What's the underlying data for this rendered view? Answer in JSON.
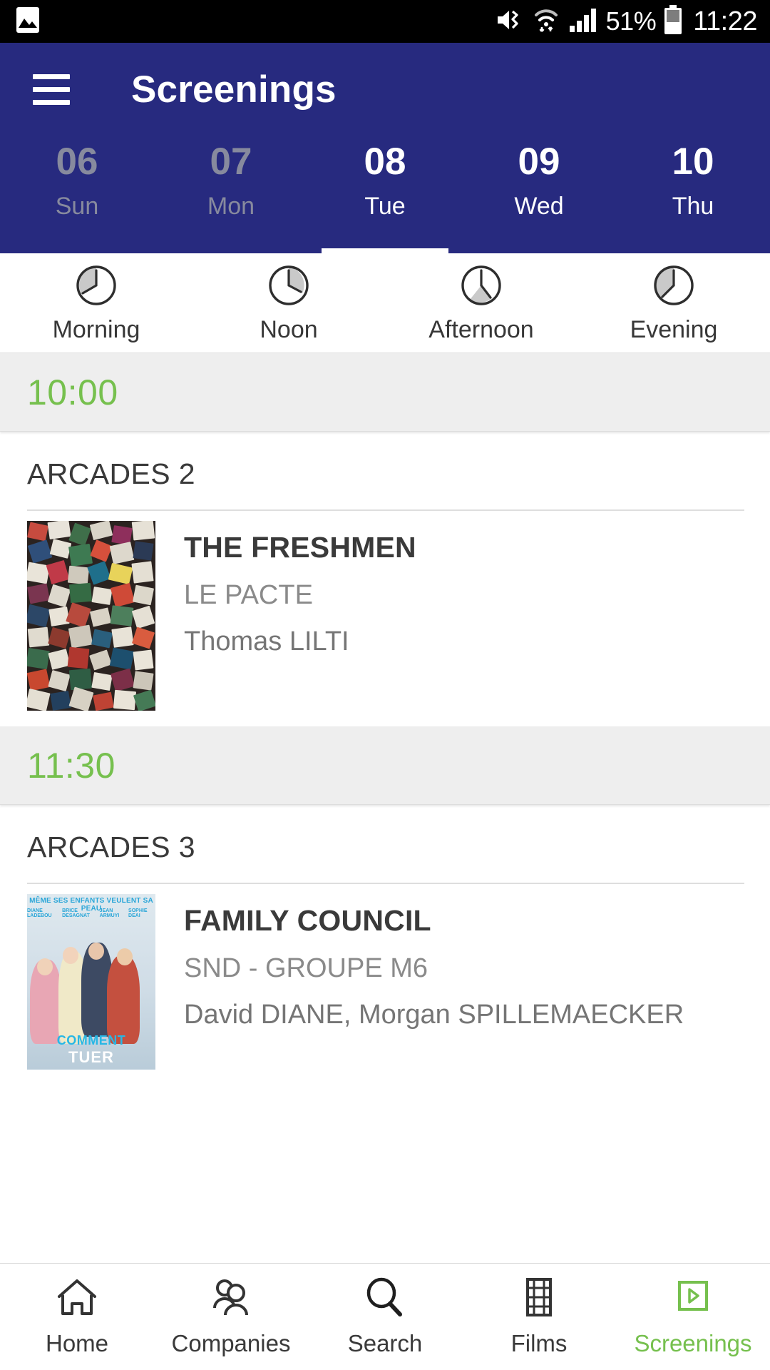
{
  "status_bar": {
    "icons": [
      "image-icon",
      "mute-icon",
      "wifi-icon",
      "signal-icon"
    ],
    "battery_percent": "51%",
    "time": "11:22"
  },
  "app_bar": {
    "menu_icon": "hamburger-menu-icon",
    "title": "Screenings"
  },
  "dates": [
    {
      "num": "06",
      "day": "Sun",
      "state": "past"
    },
    {
      "num": "07",
      "day": "Mon",
      "state": "past"
    },
    {
      "num": "08",
      "day": "Tue",
      "state": "active"
    },
    {
      "num": "09",
      "day": "Wed",
      "state": "future"
    },
    {
      "num": "10",
      "day": "Thu",
      "state": "future"
    }
  ],
  "periods": [
    {
      "label": "Morning",
      "icon": "clock-morning-icon"
    },
    {
      "label": "Noon",
      "icon": "clock-noon-icon"
    },
    {
      "label": "Afternoon",
      "icon": "clock-afternoon-icon"
    },
    {
      "label": "Evening",
      "icon": "clock-evening-icon"
    }
  ],
  "screenings": [
    {
      "time": "10:00",
      "venue": "ARCADES 2",
      "film": {
        "title": "THE FRESHMEN",
        "company": "LE PACTE",
        "director": "Thomas LILTI",
        "poster": "collage-poster"
      }
    },
    {
      "time": "11:30",
      "venue": "ARCADES 3",
      "film": {
        "title": "FAMILY COUNCIL",
        "company": "SND - GROUPE M6",
        "director": "David  DIANE, Morgan SPILLEMAECKER",
        "poster": "family-poster",
        "poster_text": {
          "tagline": "MÊME SES ENFANTS VEULENT SA PEAU",
          "cast": [
            "DIANE LADEBOU",
            "BRICE DESAGNAT",
            "JEAN ARMUYI",
            "SOPHIE DEAI"
          ],
          "title_line1": "COMMENT",
          "title_line2": "TUER"
        }
      }
    }
  ],
  "bottom_nav": [
    {
      "label": "Home",
      "icon": "home-icon",
      "active": false
    },
    {
      "label": "Companies",
      "icon": "people-icon",
      "active": false
    },
    {
      "label": "Search",
      "icon": "search-icon",
      "active": false
    },
    {
      "label": "Films",
      "icon": "film-strip-icon",
      "active": false
    },
    {
      "label": "Screenings",
      "icon": "play-box-icon",
      "active": true
    }
  ],
  "colors": {
    "app_bar": "#272a7f",
    "accent_green": "#76c04e",
    "time_header_bg": "#eeeeee",
    "text_dark": "#3a3a3a",
    "text_muted": "#8a8a8a",
    "date_inactive": "#878a9e"
  }
}
